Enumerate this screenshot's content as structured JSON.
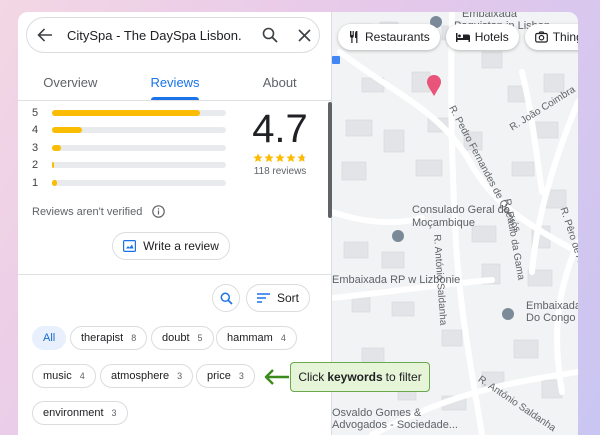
{
  "search": {
    "query": "CitySpa - The DaySpa Lisbon."
  },
  "tabs": [
    {
      "label": "Overview"
    },
    {
      "label": "Reviews",
      "active": true
    },
    {
      "label": "About"
    }
  ],
  "rating_breakdown": [
    {
      "stars": "5",
      "fraction": 0.85
    },
    {
      "stars": "4",
      "fraction": 0.17
    },
    {
      "stars": "3",
      "fraction": 0.05
    },
    {
      "stars": "2",
      "fraction": 0.01
    },
    {
      "stars": "1",
      "fraction": 0.03
    }
  ],
  "summary": {
    "score": "4.7",
    "stars_filled": 4.7,
    "review_count": "118 reviews"
  },
  "notice": {
    "text": "Reviews aren't verified"
  },
  "actions": {
    "write_review": "Write a review",
    "sort": "Sort"
  },
  "keywords": [
    {
      "label": "All",
      "count": "",
      "selected": true
    },
    {
      "label": "therapist",
      "count": "8"
    },
    {
      "label": "doubt",
      "count": "5"
    },
    {
      "label": "hammam",
      "count": "4"
    },
    {
      "label": "music",
      "count": "4"
    },
    {
      "label": "atmosphere",
      "count": "3"
    },
    {
      "label": "price",
      "count": "3"
    },
    {
      "label": "environment",
      "count": "3"
    }
  ],
  "callout": {
    "pre": "Click",
    "bold": "keywords",
    "post": "to filter"
  },
  "map_chips": [
    {
      "label": "Restaurants",
      "icon": "fork-knife-icon"
    },
    {
      "label": "Hotels",
      "icon": "bed-icon"
    },
    {
      "label": "Things",
      "icon": "camera-icon"
    }
  ],
  "map_labels": {
    "top1": "Embaixada",
    "top2": "Paquistan in Lisbon",
    "consulado1": "Consulado Geral de",
    "consulado2": "Moçambique",
    "embaixada_rp": "Embaixada RP w Lizbonie",
    "congo1": "Embaixada",
    "congo2": "Do Congo RD",
    "bottom1": "Osvaldo Gomes &",
    "bottom2": "Advogados - Sociedade..."
  },
  "streets": {
    "joao": "R. João Coimbra",
    "pedro": "R. Pedro Fernandes de Queirós",
    "paulo": "R. Paulo da Gama",
    "pero": "R. Pêro de Alenquer",
    "saldanha": "R. António Saldanha",
    "saldanha2": "R. António Saldanha"
  },
  "colors": {
    "accent": "#1a73e8",
    "star": "#fbbc04",
    "callout_bg": "#e6f4d7",
    "callout_border": "#6aa84f"
  }
}
